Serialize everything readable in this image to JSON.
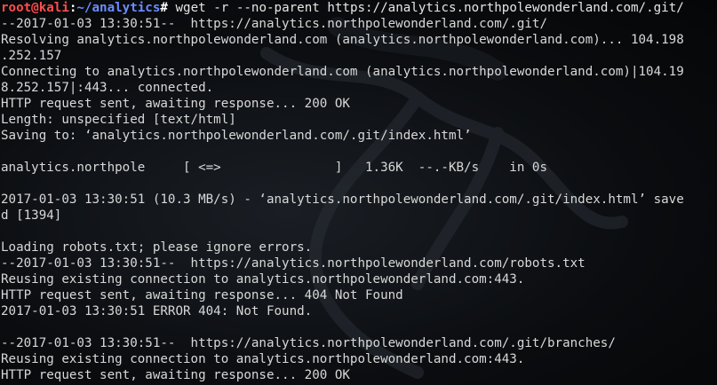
{
  "prompt": {
    "user_host": "root@kali",
    "separator": ":",
    "path": "~/analytics",
    "symbol": "# ",
    "command": "wget -r --no-parent https://analytics.northpolewonderland.com/.git/"
  },
  "output_lines": [
    "--2017-01-03 13:30:51--  https://analytics.northpolewonderland.com/.git/",
    "Resolving analytics.northpolewonderland.com (analytics.northpolewonderland.com)... 104.198",
    ".252.157",
    "Connecting to analytics.northpolewonderland.com (analytics.northpolewonderland.com)|104.19",
    "8.252.157|:443... connected.",
    "HTTP request sent, awaiting response... 200 OK",
    "Length: unspecified [text/html]",
    "Saving to: ‘analytics.northpolewonderland.com/.git/index.html’",
    "",
    "analytics.northpole     [ <=>               ]   1.36K  --.-KB/s    in 0s",
    "",
    "2017-01-03 13:30:51 (10.3 MB/s) - ‘analytics.northpolewonderland.com/.git/index.html’ save",
    "d [1394]",
    "",
    "Loading robots.txt; please ignore errors.",
    "--2017-01-03 13:30:51--  https://analytics.northpolewonderland.com/robots.txt",
    "Reusing existing connection to analytics.northpolewonderland.com:443.",
    "HTTP request sent, awaiting response... 404 Not Found",
    "2017-01-03 13:30:51 ERROR 404: Not Found.",
    "",
    "--2017-01-03 13:30:51--  https://analytics.northpolewonderland.com/.git/branches/",
    "Reusing existing connection to analytics.northpolewonderland.com:443.",
    "HTTP request sent, awaiting response... 200 OK"
  ],
  "colors": {
    "user_host": "#ff4d4d",
    "path": "#6b8cff",
    "text": "#d8d8d8",
    "background": "#0a0c0f"
  }
}
